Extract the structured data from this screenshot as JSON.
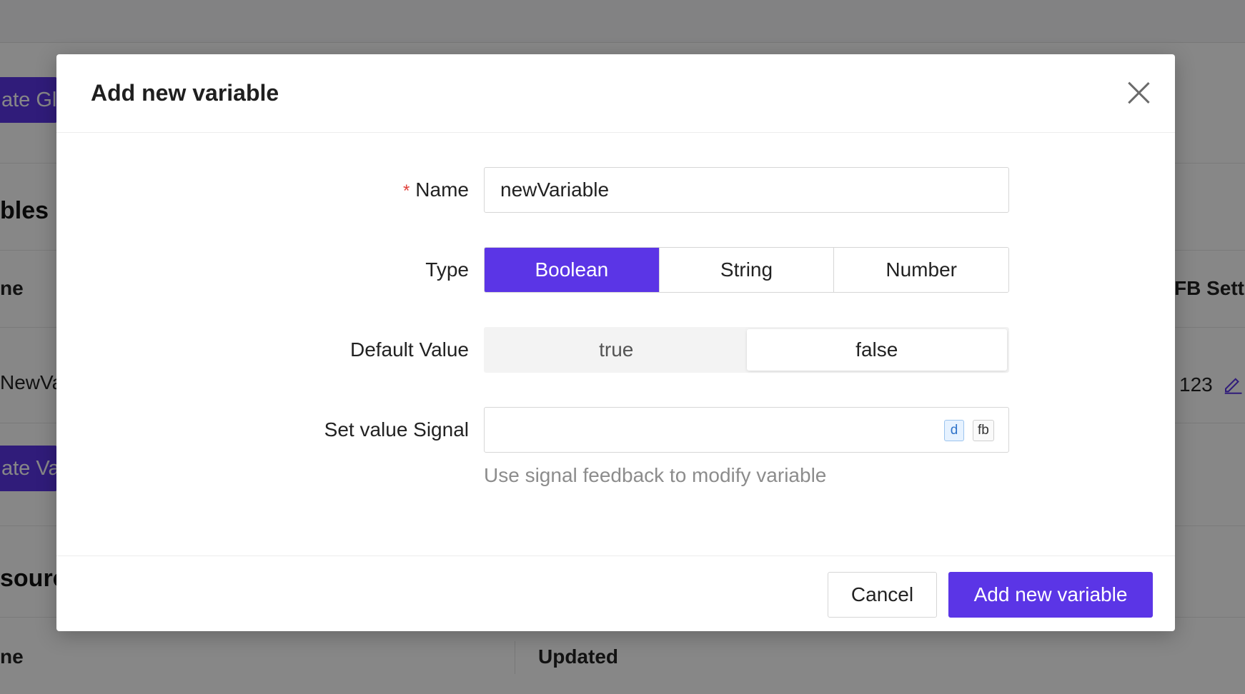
{
  "background": {
    "button_1_label": "ate Glo",
    "heading_1": "bles",
    "col_name_header_1": "ne",
    "col_fb_header": "FB Sett",
    "row_1_name": "NewVa",
    "row_1_value": "123",
    "button_2_label": "ate Var",
    "heading_2": "sourc",
    "col_name_header_2": "ne",
    "col_updated_header": "Updated"
  },
  "modal": {
    "title": "Add new variable",
    "fields": {
      "name": {
        "required_mark": "*",
        "label": "Name",
        "value": "newVariable"
      },
      "type": {
        "label": "Type",
        "options": [
          "Boolean",
          "String",
          "Number"
        ],
        "selected": "Boolean"
      },
      "default_value": {
        "label": "Default Value",
        "options": [
          "true",
          "false"
        ],
        "selected": "false"
      },
      "signal": {
        "label": "Set value Signal",
        "value": "",
        "tags": [
          "d",
          "fb"
        ],
        "help": "Use signal feedback to modify variable"
      }
    },
    "footer": {
      "cancel_label": "Cancel",
      "submit_label": "Add new variable"
    }
  },
  "colors": {
    "accent": "#5b35e6",
    "required": "#e0403a",
    "overlay": "rgba(0,0,0,0.47)"
  }
}
